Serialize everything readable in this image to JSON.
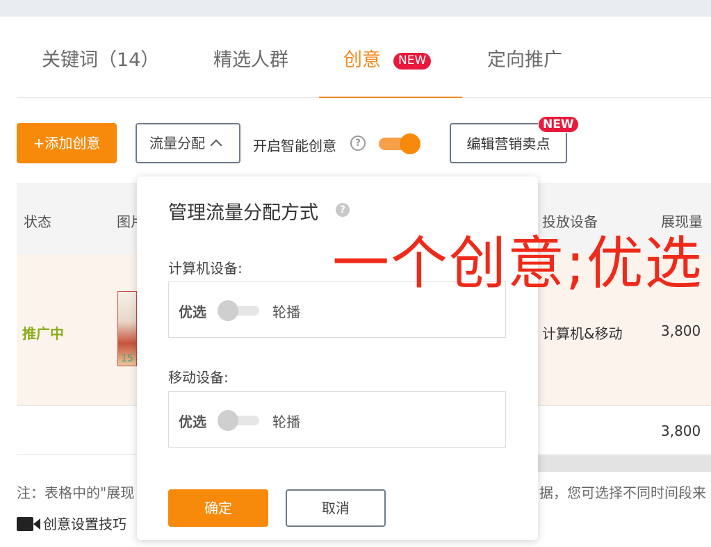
{
  "tabs": [
    {
      "label": "关键词（14）"
    },
    {
      "label": "精选人群"
    },
    {
      "label": "创意",
      "badge": "NEW"
    },
    {
      "label": "定向推广"
    }
  ],
  "toolbar": {
    "add_label": "+添加创意",
    "flow_label": "流量分配",
    "smart_label": "开启智能创意",
    "smart_enabled": true,
    "edit_label": "编辑营销卖点",
    "edit_badge": "NEW"
  },
  "table": {
    "headers": [
      "状态",
      "图片",
      "投放设备",
      "展现量"
    ],
    "rows": [
      {
        "status": "推广中",
        "thumb_text": "15",
        "device": "计算机&移动",
        "impressions": "3,800"
      },
      {
        "impressions": "3,800"
      }
    ]
  },
  "note": {
    "left": "注：表格中的\"展现",
    "right": "据，您可选择不同时间段来"
  },
  "tips_label": "创意设置技巧",
  "popover": {
    "title": "管理流量分配方式",
    "computer_label": "计算机设备:",
    "mobile_label": "移动设备:",
    "option_left": "优选",
    "option_right": "轮播",
    "ok_label": "确定",
    "cancel_label": "取消"
  },
  "annotation": "一个创意;优选",
  "colors": {
    "accent": "#f78a0b",
    "status_active": "#8aac1c",
    "badge": "#e8193c",
    "annotation": "#ee2a1a"
  }
}
